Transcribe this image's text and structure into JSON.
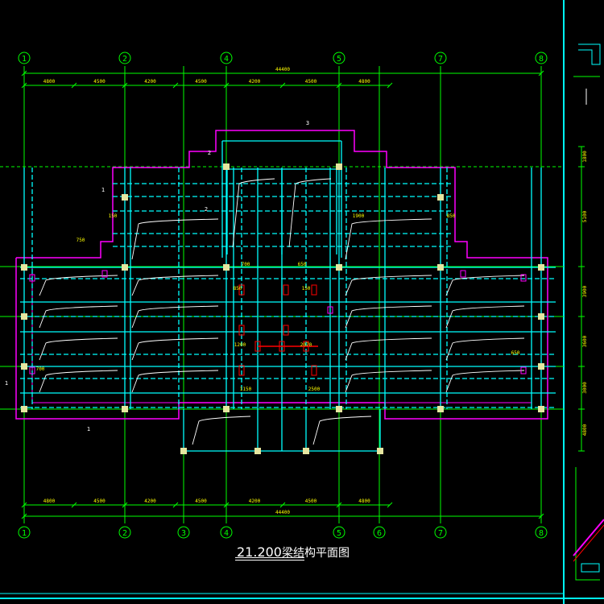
{
  "drawing": {
    "title_elevation": "21.200",
    "title_suffix": "梁结构平面图",
    "colors": {
      "background": "#000000",
      "axis": "#00ff00",
      "beam": "#00ffff",
      "slab": "#ff00ff",
      "column": "#e6e6a0",
      "rebar": "#ffffff",
      "section_mark": "#ff0000",
      "dim_text": "#ffff00"
    },
    "axes_top": [
      "1",
      "2",
      "4",
      "5",
      "7",
      "8"
    ],
    "axes_bottom": [
      "1",
      "2",
      "3",
      "4",
      "5",
      "6",
      "7",
      "8"
    ],
    "top_segment_dims": [
      "4800",
      "4500",
      "4200",
      "4500",
      "4200",
      "4500",
      "4800"
    ],
    "top_overall_dim": "44400",
    "bottom_segment_dims": [
      "4800",
      "4500",
      "4200",
      "4500",
      "4200",
      "4500",
      "4800"
    ],
    "bottom_overall_dim": "44400",
    "right_dims": [
      "1800",
      "5100",
      "3900",
      "3600",
      "3000",
      "4800"
    ],
    "beam_tags": [
      "700",
      "650",
      "850",
      "150",
      "1200",
      "2070",
      "1150",
      "2500",
      "750",
      "1900"
    ],
    "slab_marks": [
      "1",
      "2",
      "3"
    ]
  }
}
